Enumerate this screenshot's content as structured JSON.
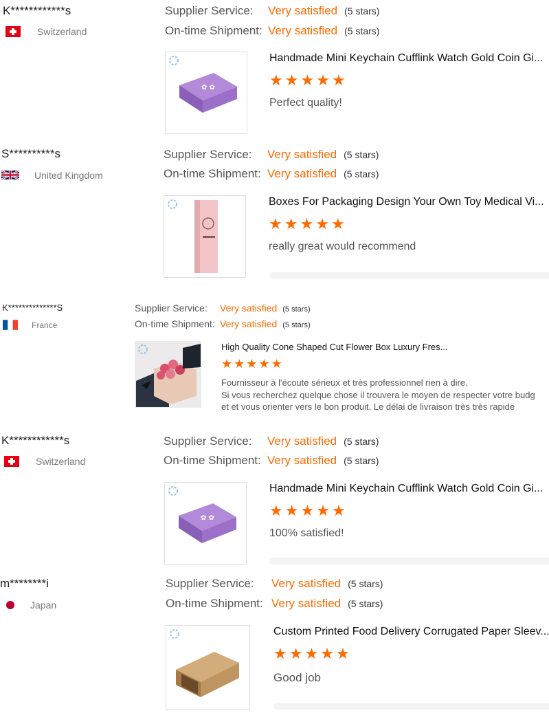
{
  "reviews": [
    {
      "reviewer": "K************s",
      "country": "Switzerland",
      "supplier_label": "Supplier Service:",
      "supplier_value": "Very satisfied",
      "supplier_stars": "(5 stars)",
      "shipment_label": "On-time Shipment:",
      "shipment_value": "Very satisfied",
      "shipment_stars": "(5 stars)",
      "product_title": "Handmade Mini Keychain Cufflink Watch Gold Coin Gi...",
      "rating": 5,
      "text": "Perfect quality!"
    },
    {
      "reviewer": "S**********s",
      "country": "United Kingdom",
      "supplier_label": "Supplier Service:",
      "supplier_value": "Very satisfied",
      "supplier_stars": "(5 stars)",
      "shipment_label": "On-time Shipment:",
      "shipment_value": "Very satisfied",
      "shipment_stars": "(5 stars)",
      "product_title": "Boxes For Packaging Design Your Own Toy Medical Vi...",
      "rating": 5,
      "text": "really great would recommend"
    },
    {
      "reviewer": "K**************S",
      "country": "France",
      "supplier_label": "Supplier Service:",
      "supplier_value": "Very satisfied",
      "supplier_stars": "(5 stars)",
      "shipment_label": "On-time Shipment:",
      "shipment_value": "Very satisfied",
      "shipment_stars": "(5 stars)",
      "product_title": "High Quality Cone Shaped Cut Flower Box Luxury Fres...",
      "rating": 5,
      "text_line1": "Fournisseur à l'écoute sérieux et très professionnel rien à dire.",
      "text_line2": "Si vous recherchez quelque chose il trouvera le moyen de respecter votre budg",
      "text_line3": "et et vous orienter vers le bon produit. Le délai de livraison très très rapide"
    },
    {
      "reviewer": "K************s",
      "country": "Switzerland",
      "supplier_label": "Supplier Service:",
      "supplier_value": "Very satisfied",
      "supplier_stars": "(5 stars)",
      "shipment_label": "On-time Shipment:",
      "shipment_value": "Very satisfied",
      "shipment_stars": "(5 stars)",
      "product_title": "Handmade Mini Keychain Cufflink Watch Gold Coin Gi...",
      "rating": 5,
      "text": "100% satisfied!"
    },
    {
      "reviewer": "m********i",
      "country": "Japan",
      "supplier_label": "Supplier Service:",
      "supplier_value": "Very satisfied",
      "supplier_stars": "(5 stars)",
      "shipment_label": "On-time Shipment:",
      "shipment_value": "Very satisfied",
      "shipment_stars": "(5 stars)",
      "product_title": "Custom Printed Food Delivery Corrugated Paper Sleev...",
      "rating": 5,
      "text": "Good job"
    }
  ],
  "colors": {
    "accent": "#ff6a00",
    "label": "#555555",
    "divider": "#f4f4f4"
  },
  "icons": {
    "star": "star-icon"
  }
}
